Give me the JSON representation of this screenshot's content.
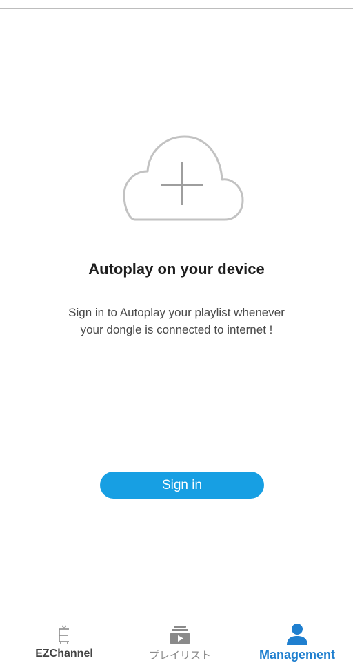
{
  "main": {
    "title": "Autoplay on your device",
    "description_line1": "Sign in to Autoplay your playlist whenever",
    "description_line2": "your dongle is connected to internet !",
    "cloud_icon": "cloud-plus-icon",
    "signin_label": "Sign in"
  },
  "bottom_nav": {
    "items": [
      {
        "label": "EZChannel",
        "icon": "tv-icon",
        "active": false
      },
      {
        "label": "プレイリスト",
        "icon": "playlist-icon",
        "active": false
      },
      {
        "label": "Management",
        "icon": "person-icon",
        "active": true
      }
    ]
  },
  "colors": {
    "accent": "#179fe3",
    "active_tab": "#1f7fcf",
    "icon_gray": "#b8b8b8"
  }
}
